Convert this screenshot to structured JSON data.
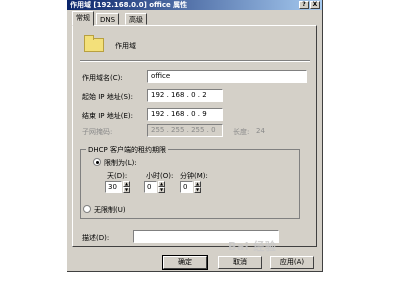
{
  "window": {
    "title": "作用域 [192.168.0.0] office 属性",
    "help_label": "?",
    "close_label": "X"
  },
  "tabs": [
    {
      "label": "常规",
      "active": true
    },
    {
      "label": "DNS",
      "active": false
    },
    {
      "label": "高级",
      "active": false
    }
  ],
  "header": {
    "icon": "folder-icon",
    "name": "作用域"
  },
  "fields": {
    "scope_name_label": "作用域名(C):",
    "scope_name_value": "office",
    "start_ip_label": "起始 IP 地址(S):",
    "start_ip_value": "192 . 168 . 0 . 2",
    "end_ip_label": "结束 IP 地址(E):",
    "end_ip_value": "192 . 168 . 0 . 9",
    "subnet_label": "子网掩码:",
    "subnet_value": "255 . 255 . 255 . 0",
    "length_label": "长度:",
    "length_value": "24"
  },
  "lease": {
    "group_title": "DHCP 客户端的租约期限",
    "limited_label": "限制为(L):",
    "days_label": "天(D):",
    "hours_label": "小时(O):",
    "minutes_label": "分钟(M):",
    "days_value": "30",
    "hours_value": "0",
    "minutes_value": "0",
    "unlimited_label": "无限制(U)",
    "selected": "limited"
  },
  "description": {
    "label": "描述(D):",
    "value": ""
  },
  "buttons": {
    "ok": "确定",
    "cancel": "取消",
    "apply": "应用(A)"
  },
  "watermark": "Bai 经验"
}
